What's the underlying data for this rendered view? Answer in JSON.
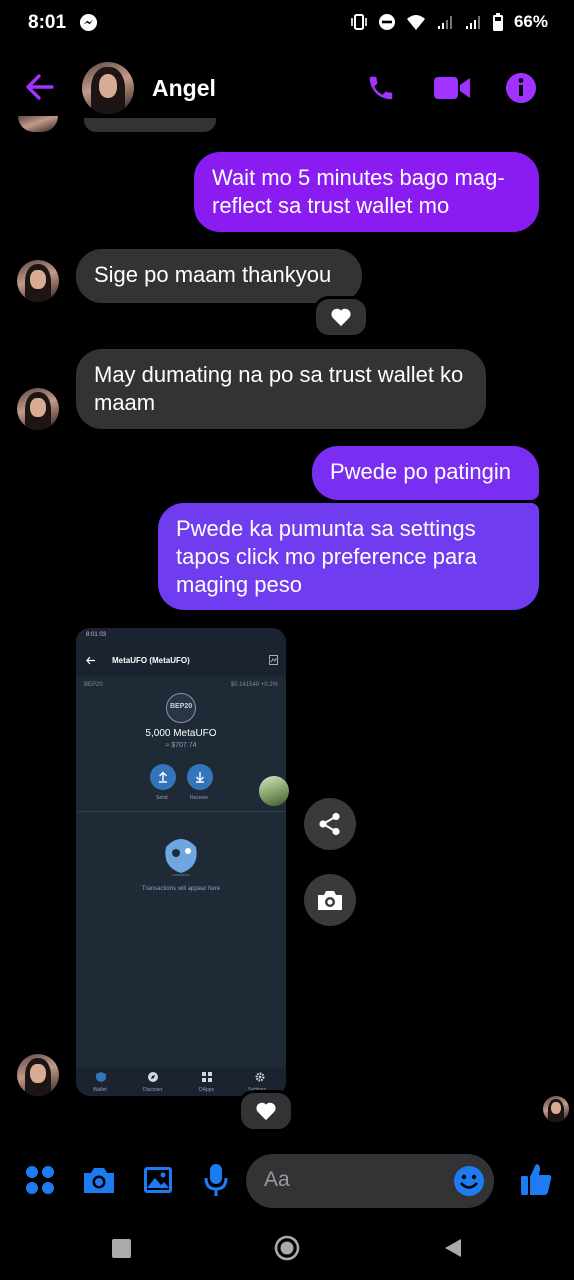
{
  "status_bar": {
    "time": "8:01",
    "battery": "66%"
  },
  "header": {
    "contact_name": "Angel"
  },
  "messages": [
    {
      "side": "sent",
      "text": "Wait mo 5 minutes bago mag-reflect sa trust wallet mo"
    },
    {
      "side": "received",
      "text": "Sige po maam thankyou",
      "reaction": "heart"
    },
    {
      "side": "received",
      "text": "May dumating na po sa trust wallet ko maam"
    },
    {
      "side": "sent",
      "text": "Pwede po patingin"
    },
    {
      "side": "sent",
      "text": "Pwede ka pumunta sa settings tapos click mo preference para maging peso"
    }
  ],
  "shared_image": {
    "status_time": "8:01 03",
    "title": "MetaUFO (MetaUFO)",
    "network": "BEP20",
    "price_line": "$0.141549 +0.2%",
    "badge": "BEP20",
    "balance": "5,000 MetaUFO",
    "fiat": "≈ $707.74",
    "send_label": "Send",
    "receive_label": "Receive",
    "empty_text": "Transactions will appear here",
    "nav": [
      "Wallet",
      "Discover",
      "DApps",
      "Settings"
    ],
    "reaction": "heart"
  },
  "composer": {
    "placeholder": "Aa"
  },
  "colors": {
    "sent": "#8a1cf2",
    "sent_gradient_end": "#6f3cf0",
    "received": "#333336",
    "accent": "#a033ff",
    "composer_icon": "#1e7cf2"
  },
  "icons": [
    "back-arrow-icon",
    "phone-icon",
    "video-icon",
    "info-icon",
    "menu-dots-icon",
    "camera-icon",
    "gallery-icon",
    "mic-icon",
    "emoji-icon",
    "like-icon",
    "share-icon",
    "heart-icon"
  ]
}
